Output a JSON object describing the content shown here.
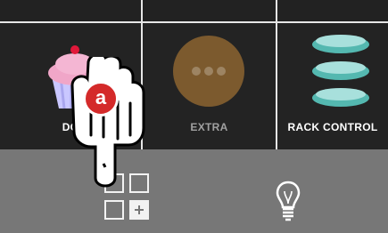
{
  "tiles": [
    {
      "label": "DO",
      "icon": "cupcake-icon"
    },
    {
      "label": "EXTRA",
      "icon": "more-dots-icon"
    },
    {
      "label": "RACK CONTROL",
      "icon": "rack-plates-icon"
    }
  ],
  "pointer": {
    "letter": "a",
    "icon": "pointing-hand-icon"
  },
  "bottom_bar": {
    "icons": [
      "add-tile-icon",
      "lightbulb-icon"
    ]
  },
  "colors": {
    "accent_red": "#d42a2a",
    "tile_bg": "#232323",
    "bar_bg": "#777777"
  }
}
